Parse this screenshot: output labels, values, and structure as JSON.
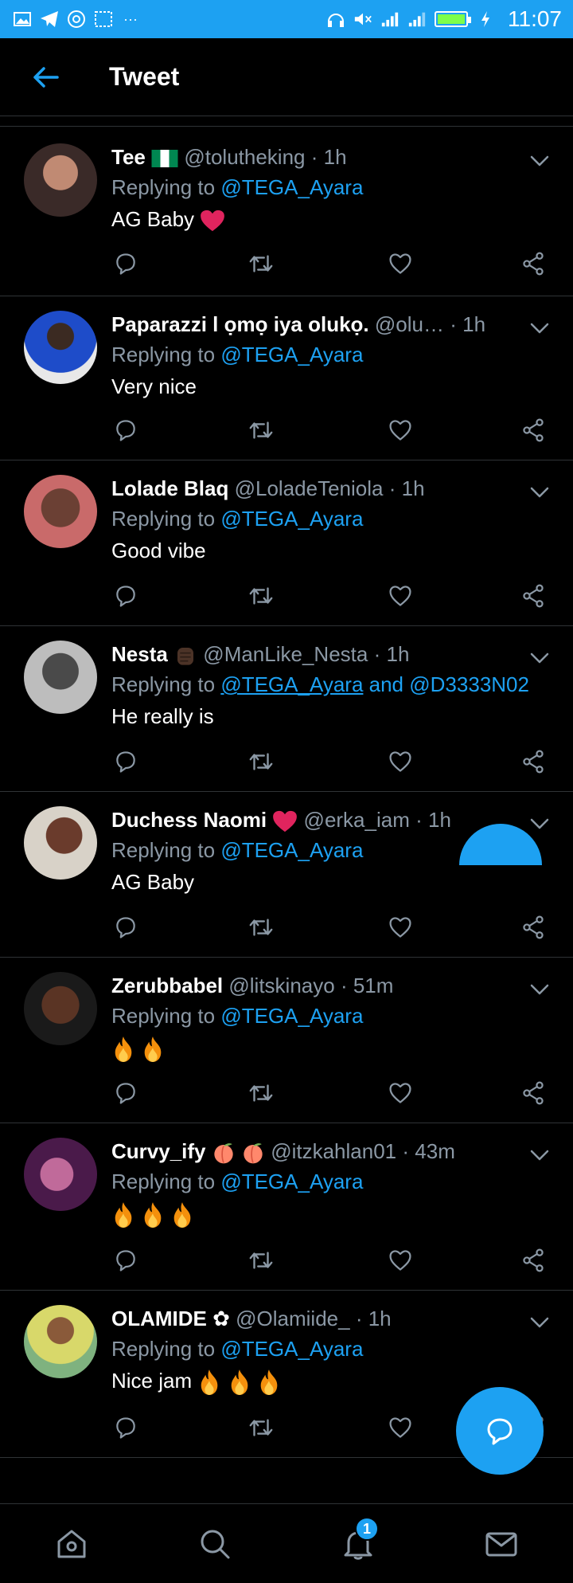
{
  "status_bar": {
    "time": "11:07",
    "battery_level": 1.0
  },
  "header": {
    "title": "Tweet"
  },
  "tweets": [
    {
      "name": "Tee",
      "name_icon": "nigeria-flag",
      "handle": "@tolutheking",
      "time": "1h",
      "replying_prefix": "Replying to",
      "mention": "@TEGA_Ayara",
      "text": "AG Baby",
      "text_emoji": "red-heart"
    },
    {
      "name": "Paparazzi l ọmọ iya olukọ.",
      "handle": "@olu…",
      "time": "1h",
      "replying_prefix": "Replying to",
      "mention": "@TEGA_Ayara",
      "text": "Very nice"
    },
    {
      "name": "Lolade Blaq",
      "handle": "@LoladeTeniola",
      "time": "1h",
      "replying_prefix": "Replying to",
      "mention": "@TEGA_Ayara",
      "text": "Good vibe"
    },
    {
      "name": "Nesta",
      "name_icon": "raised-fist",
      "handle": "@ManLike_Nesta",
      "time": "1h",
      "replying_prefix": "Replying to",
      "mention": "@TEGA_Ayara",
      "mention_join": "and",
      "mention2": "@D3333N02",
      "text": "He really is"
    },
    {
      "name": "Duchess Naomi",
      "name_icon": "red-heart",
      "handle": "@erka_iam",
      "time": "1h",
      "replying_prefix": "Replying to",
      "mention": "@TEGA_Ayara",
      "text": "AG Baby"
    },
    {
      "name": "Zerubbabel",
      "handle": "@litskinayo",
      "time": "51m",
      "replying_prefix": "Replying to",
      "mention": "@TEGA_Ayara",
      "text": "",
      "text_emoji": "fire x2"
    },
    {
      "name": "Curvy_ify",
      "name_icon": "peach x2",
      "handle": "@itzkahlan01",
      "time": "43m",
      "replying_prefix": "Replying to",
      "mention": "@TEGA_Ayara",
      "text": "",
      "text_emoji": "fire x3"
    },
    {
      "name": "OLAMIDE ✿",
      "handle": "@Olamiide_",
      "time": "1h",
      "replying_prefix": "Replying to",
      "mention": "@TEGA_Ayara",
      "text": "Nice jam",
      "text_emoji": "fire x3"
    }
  ],
  "bottom_nav": {
    "notification_count": "1"
  },
  "colors": {
    "accent": "#1da1f2",
    "background": "#000000",
    "secondary_text": "#8b98a5",
    "divider": "#2f3336"
  },
  "icons": [
    "back-arrow-icon",
    "chevron-down-icon",
    "reply-icon",
    "retweet-icon",
    "like-icon",
    "share-icon",
    "compose-icon",
    "home-icon",
    "search-icon",
    "notifications-icon",
    "messages-icon"
  ]
}
